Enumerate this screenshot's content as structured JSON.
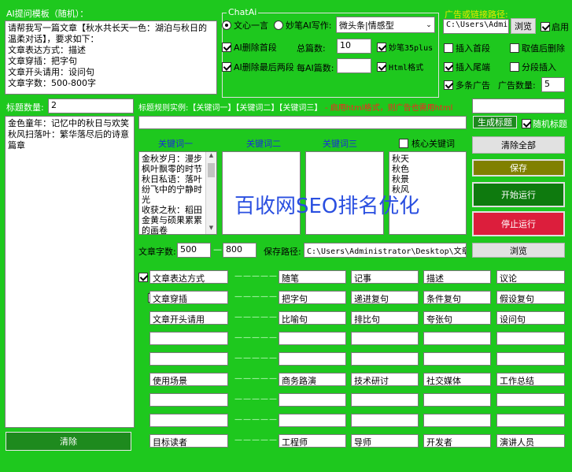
{
  "prompt_panel": {
    "title": "AI提问模板（随机）：",
    "text": "请帮我写一篇文章【秋水共长天一色：湖泊与秋日的温柔对话】，要求如下：\n文章表达方式：描述\n文章穿插：把字句\n文章开头请用：设问句\n文章字数：500-800字"
  },
  "chatai": {
    "group_label": "ChatAi",
    "radio_wenxin": "文心一言",
    "radio_miaobi": "妙笔AI写作:",
    "style_value": "微头条|情感型",
    "cb_delete_first": "AI删除首段",
    "cb_delete_last": "AI删除最后两段",
    "total_label": "总篇数:",
    "total_value": "10",
    "per_ai_label": "每AI篇数:",
    "per_ai_value": "",
    "cb_miaobi35": "妙笔35plus",
    "cb_html": "Html格式"
  },
  "ad": {
    "path_label": "广告或链接路径:",
    "path_value": "C:\\Users\\Admini",
    "browse": "浏览",
    "enable": "启用",
    "insert_first": "插入首段",
    "insert_last": "插入尾端",
    "multi_ad": "多条广告",
    "cancel_last_delete": "取值后删除",
    "split_insert": "分段插入",
    "ad_count_label": "广告数量:",
    "ad_count_value": "5"
  },
  "title_section": {
    "count_label": "标题数量:",
    "count_value": "2",
    "titles": "金色童年：记忆中的秋日与欢笑\n秋风扫落叶：繁华落尽后的诗意篇章",
    "clear_button": "清除",
    "rule_example": "标题规则实例:【关键词一】【关键词二】【关键词三】",
    "rule_note": "- 启用html格式，则广告也需用html",
    "rule_input": "",
    "generate_button": "生成标题",
    "random_title": "随机标题"
  },
  "keywords": {
    "head1": "关键词一",
    "head2": "关键词二",
    "head3": "关键词三",
    "core_label": "核心关键词",
    "kw1_text": "金秋岁月：漫步枫叶飘零的时节\n秋日私语：落叶纷飞中的宁静时光\n收获之秋：稻田金黄与硕果累累的画卷",
    "kw2_text": "",
    "kw3_text": "",
    "core_text": "秋天\n秋色\n秋景\n秋风"
  },
  "watermark": "百收网SEO排名优化",
  "buttons": {
    "clear_all": "清除全部",
    "save": "保存",
    "start": "开始运行",
    "stop": "停止运行",
    "browse": "浏览"
  },
  "length": {
    "label": "文章字数:",
    "min": "500",
    "sep": "—",
    "max": "800",
    "save_path_label": "保存路径:",
    "save_path_value": "C:\\Users\\Administrator\\Desktop\\文章"
  },
  "options": [
    {
      "checked": true,
      "name": "文章表达方式",
      "values": [
        "随笔",
        "记事",
        "描述",
        "议论"
      ]
    },
    {
      "checked": true,
      "name": "文章穿插",
      "values": [
        "把字句",
        "递进复句",
        "条件复句",
        "假设复句"
      ]
    },
    {
      "checked": true,
      "name": "文章开头请用",
      "values": [
        "比喻句",
        "排比句",
        "夸张句",
        "设问句"
      ]
    },
    {
      "checked": false,
      "name": "",
      "values": [
        "",
        "",
        "",
        ""
      ]
    },
    {
      "checked": false,
      "name": "",
      "values": [
        "",
        "",
        "",
        ""
      ]
    },
    {
      "checked": false,
      "name": "使用场景",
      "values": [
        "商务路演",
        "技术研讨",
        "社交媒体",
        "工作总结"
      ]
    },
    {
      "checked": false,
      "name": "",
      "values": [
        "",
        "",
        "",
        ""
      ]
    },
    {
      "checked": false,
      "name": "",
      "values": [
        "",
        "",
        "",
        ""
      ]
    },
    {
      "checked": false,
      "name": "目标读者",
      "values": [
        "工程师",
        "导师",
        "开发者",
        "演讲人员"
      ]
    }
  ],
  "option_dash": "—————",
  "colors": {
    "background": "#1ec81e",
    "save": "#808000",
    "start": "#0e7a0e",
    "stop": "#dc1e3c",
    "watermark": "#2a4fe0"
  }
}
